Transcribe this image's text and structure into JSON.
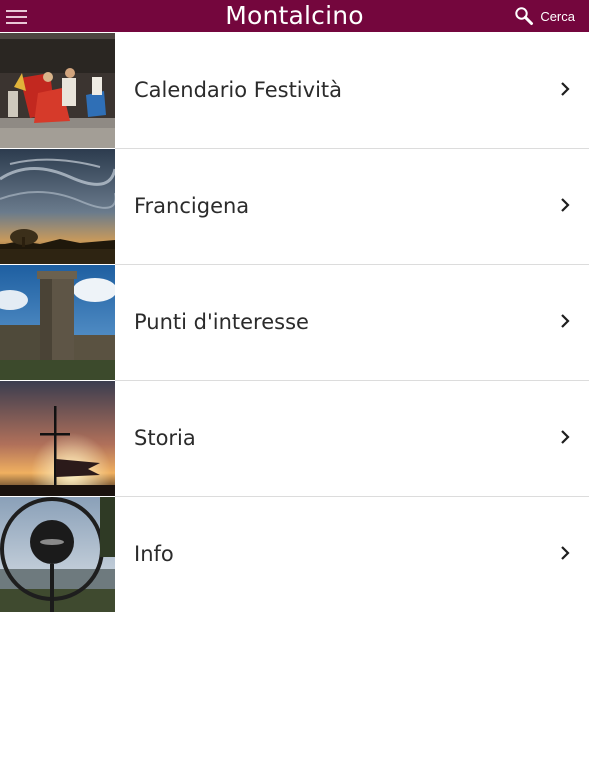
{
  "header": {
    "title": "Montalcino",
    "search_label": "Cerca",
    "background": "#74063d"
  },
  "icons": {
    "menu": "hamburger-menu-icon",
    "search": "magnifier-search-icon",
    "row": "chevron-right-icon"
  },
  "items": [
    {
      "label": "Calendario Festività",
      "image": "folk-dancers-photo"
    },
    {
      "label": "Francigena",
      "image": "dramatic-sky-landscape-photo"
    },
    {
      "label": "Punti d'interesse",
      "image": "fortress-tower-photo"
    },
    {
      "label": "Storia",
      "image": "cross-and-banner-sunset-photo"
    },
    {
      "label": "Info",
      "image": "circular-sculpture-photo"
    }
  ]
}
